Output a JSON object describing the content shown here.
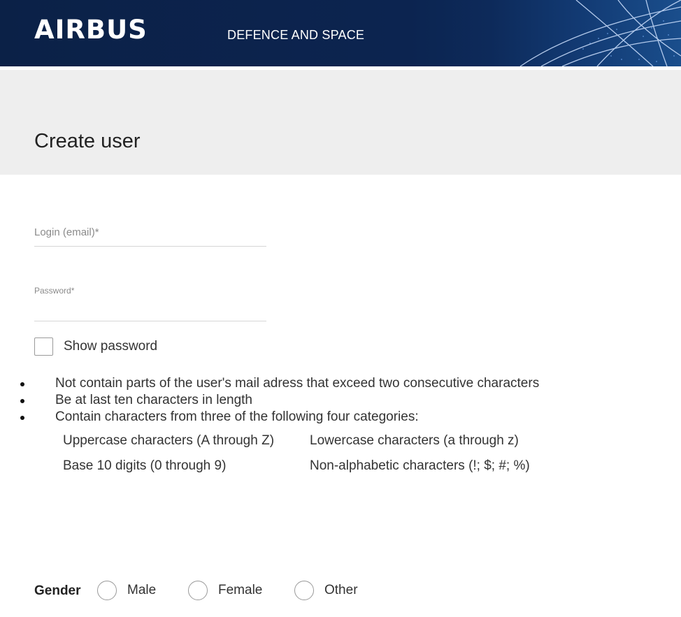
{
  "header": {
    "brand": "AIRBUS",
    "division": "DEFENCE AND SPACE"
  },
  "page": {
    "title": "Create user"
  },
  "form": {
    "login_placeholder": "Login (email)*",
    "login_value": "",
    "password_label": "Password*",
    "password_value": "",
    "show_password_label": "Show password",
    "show_password_checked": false
  },
  "password_rules": {
    "items": [
      "Not contain parts of the user's mail adress that exceed two consecutive characters",
      "Be at last ten characters in length",
      "Contain characters from three of the following four categories:"
    ],
    "categories": [
      "Uppercase characters (A through Z)",
      "Lowercase characters (a through z)",
      "Base 10 digits (0 through 9)",
      "Non-alphabetic characters (!; $; #; %)"
    ]
  },
  "gender": {
    "label": "Gender",
    "options": [
      "Male",
      "Female",
      "Other"
    ],
    "selected": ""
  },
  "colors": {
    "header_bg": "#0b2147",
    "title_band_bg": "#eeeeee",
    "text": "#333333"
  }
}
